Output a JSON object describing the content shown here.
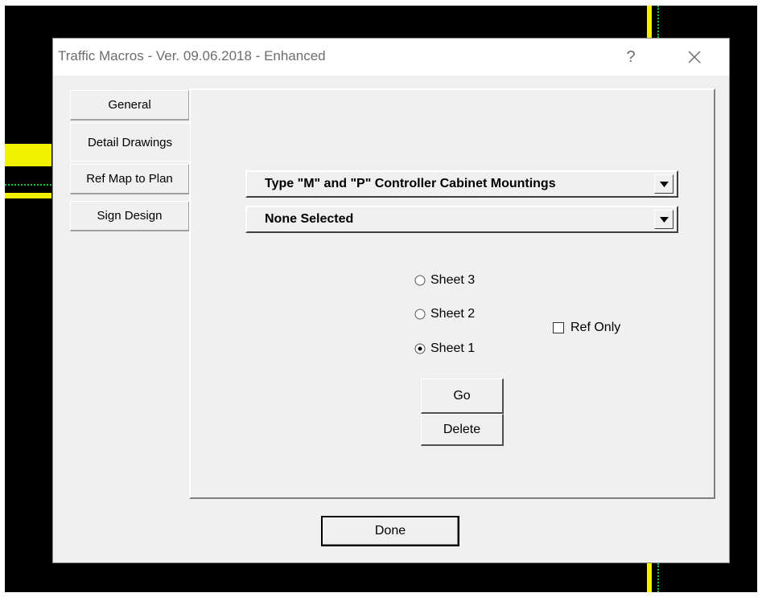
{
  "dialog": {
    "title": "Traffic Macros - Ver. 09.06.2018 - Enhanced",
    "help_label": "?"
  },
  "tabs": [
    {
      "label": "General",
      "active": false
    },
    {
      "label": "Detail Drawings",
      "active": true
    },
    {
      "label": "Ref Map to Plan",
      "active": false
    },
    {
      "label": "Sign Design",
      "active": false
    }
  ],
  "dropdowns": {
    "category": {
      "value": "Type \"M\" and \"P\" Controller Cabinet Mountings"
    },
    "detail": {
      "value": "None Selected"
    }
  },
  "sheets": {
    "options": [
      {
        "label": "Sheet 3",
        "selected": false
      },
      {
        "label": "Sheet 2",
        "selected": false
      },
      {
        "label": "Sheet 1",
        "selected": true
      }
    ]
  },
  "ref_only": {
    "label": "Ref Only",
    "checked": false
  },
  "buttons": {
    "go": "Go",
    "delete": "Delete",
    "done": "Done"
  },
  "colors": {
    "cad_background": "#000000",
    "cad_line": "#f2f200",
    "cad_dots": "#19c23a",
    "dialog_face": "#f0f0f0"
  }
}
